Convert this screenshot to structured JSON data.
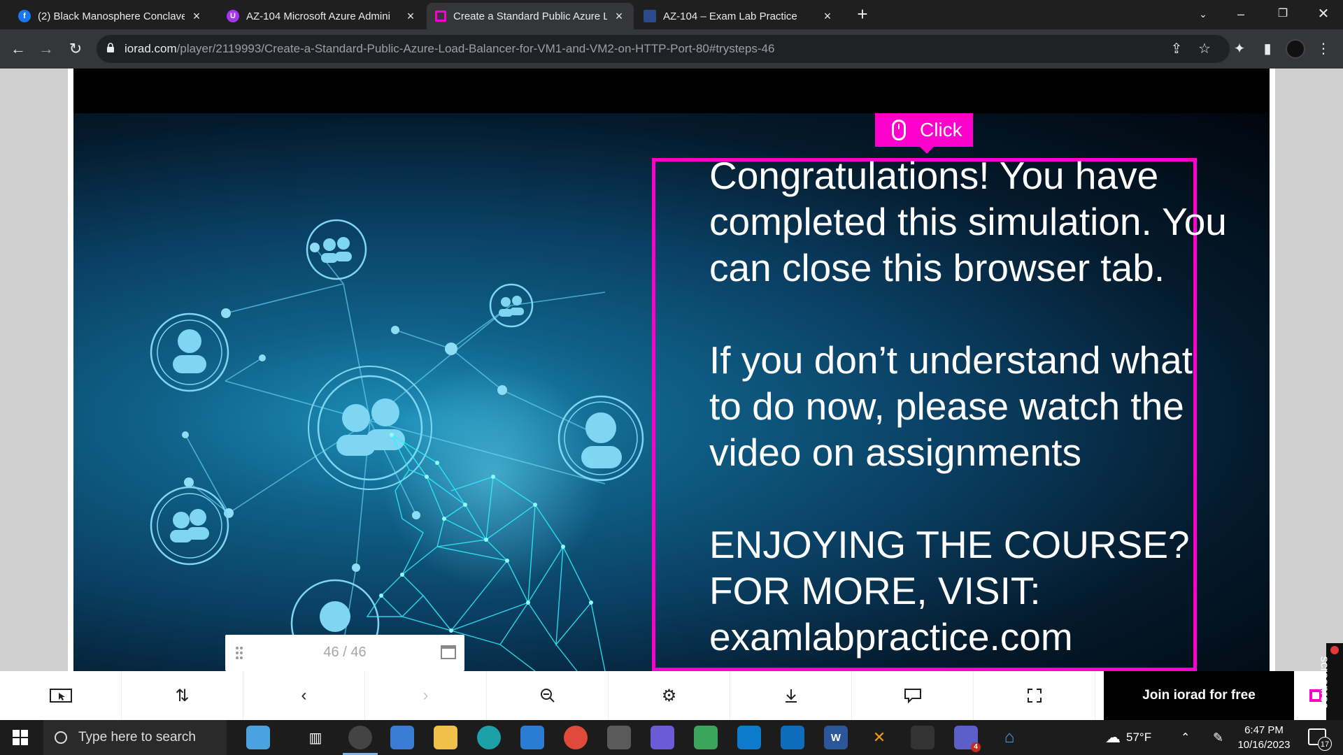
{
  "browser": {
    "tabs": [
      {
        "label": "(2) Black Manosphere Conclave |",
        "icon": "facebook-icon",
        "color": "#1877f2"
      },
      {
        "label": "AZ-104 Microsoft Azure Admini",
        "icon": "udemy-icon",
        "color": "#a435f0"
      },
      {
        "label": "Create a Standard Public Azure L",
        "icon": "iorad-icon",
        "color": "#ff00cc"
      },
      {
        "label": "AZ-104 – Exam Lab Practice",
        "icon": "examlab-icon",
        "color": "#2b4a8b"
      }
    ],
    "active_tab": 2,
    "new_tab": "+",
    "url_host": "iorad.com",
    "url_path": "/player/2119993/Create-a-Standard-Public-Azure-Load-Balancer-for-VM1-and-VM2-on-HTTP-Port-80#trysteps-46"
  },
  "slide": {
    "click_label": "Click",
    "message_lines": [
      "Congratulations! You have",
      "completed this simulation. You",
      "can close this browser tab.",
      "",
      "If you don’t understand what",
      "to do now, please watch the",
      "video on assignments",
      "",
      "ENJOYING THE COURSE?",
      "FOR MORE, VISIT:",
      "examlabpractice.com"
    ],
    "step_counter": "46 / 46",
    "accent_color": "#ff00cc"
  },
  "player_controls": {
    "join_label": "Join iorad for free"
  },
  "recorder_label": "screenrec",
  "taskbar": {
    "search_placeholder": "Type here to search",
    "weather": "57°F",
    "time": "6:47 PM",
    "date": "10/16/2023",
    "notification_count": "17",
    "teams_badge": "4"
  }
}
